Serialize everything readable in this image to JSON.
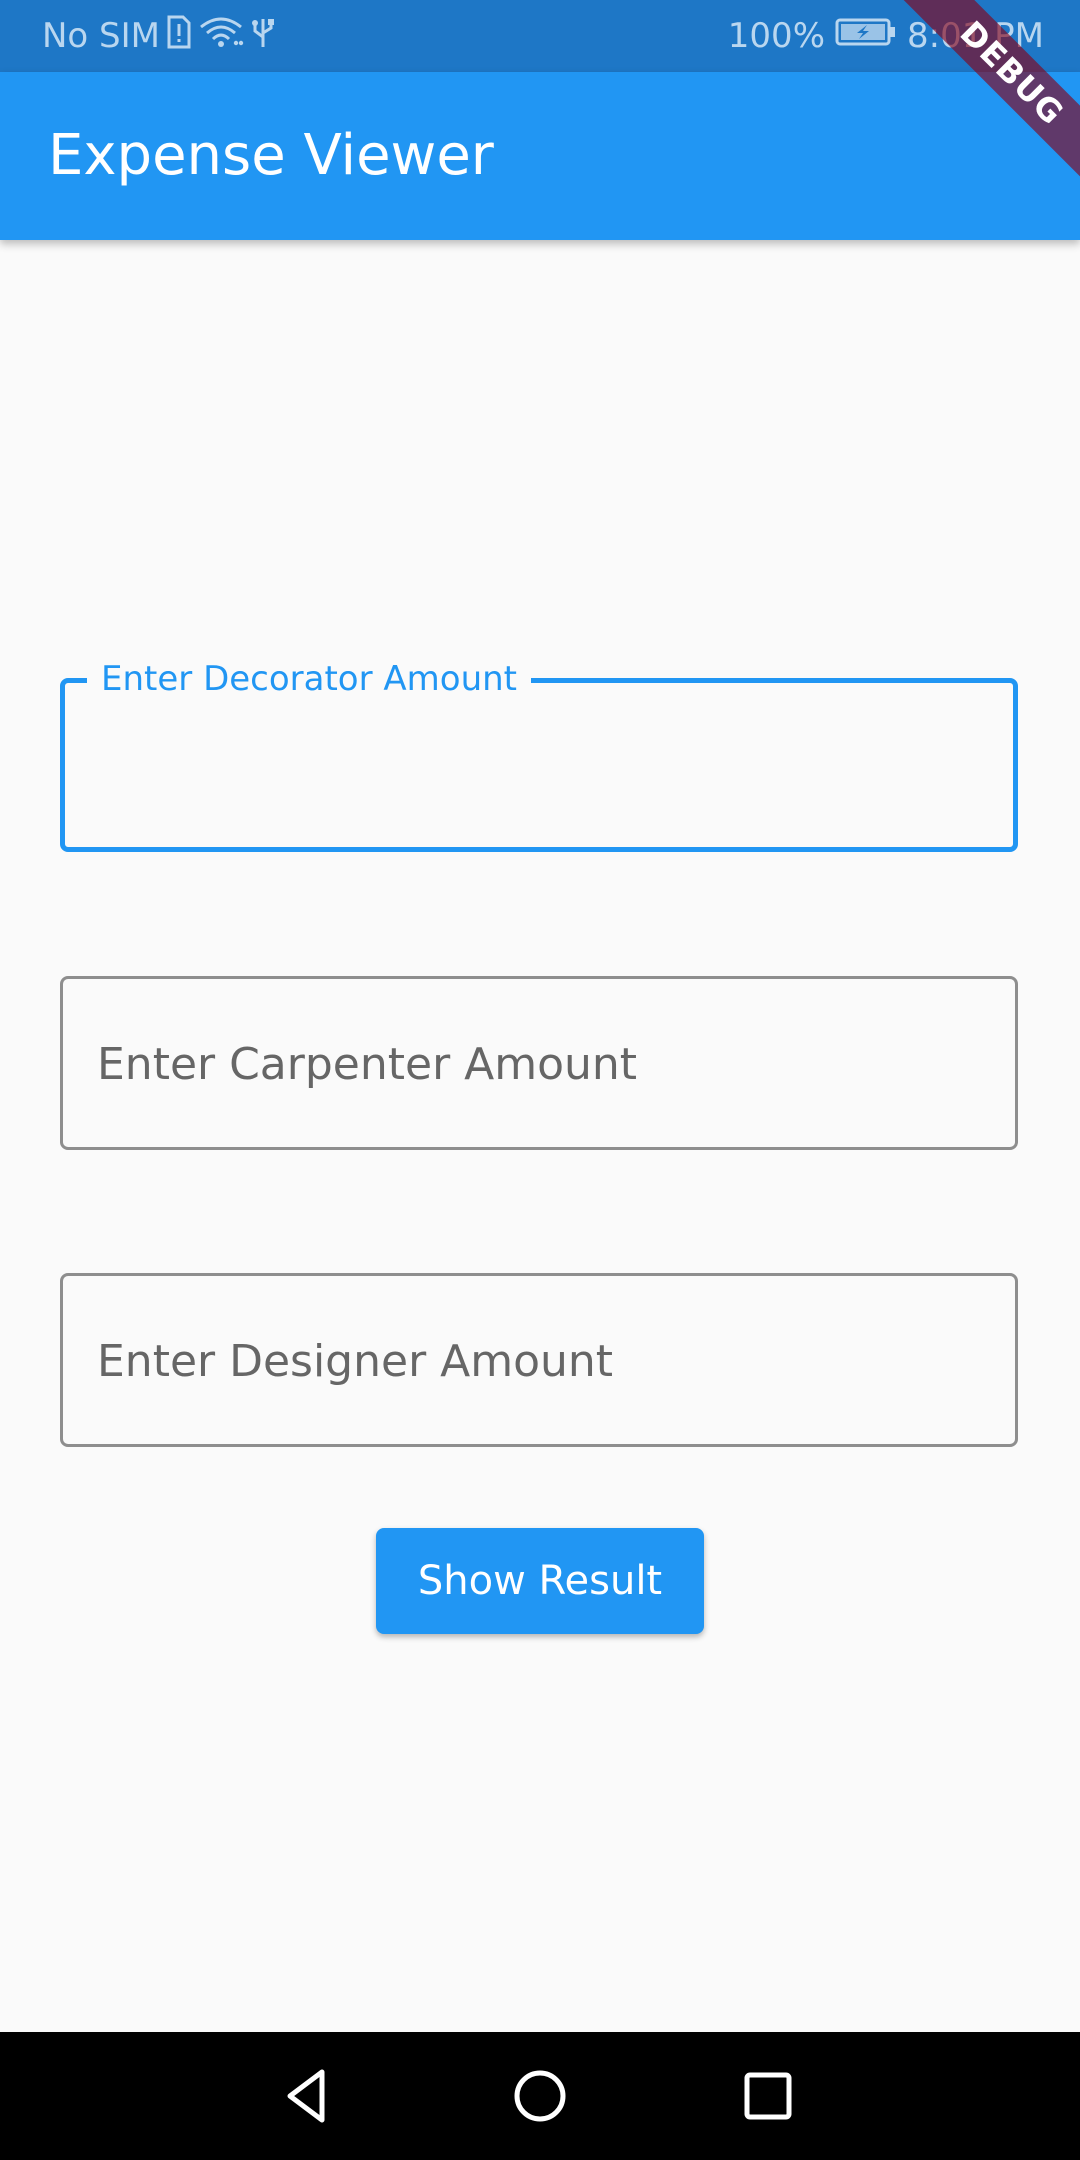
{
  "status_bar": {
    "carrier": "No SIM",
    "battery": "100%",
    "time": "8:01 PM",
    "icons": [
      "sim-alert-icon",
      "wifi-icon",
      "usb-icon",
      "battery-charging-icon"
    ]
  },
  "app_bar": {
    "title": "Expense Viewer",
    "color": "#2196f3"
  },
  "debug_banner": {
    "label": "DEBUG"
  },
  "form": {
    "decorator": {
      "label": "Enter Decorator Amount",
      "value": "",
      "focused": true
    },
    "carpenter": {
      "placeholder": "Enter Carpenter Amount",
      "value": ""
    },
    "designer": {
      "placeholder": "Enter Designer Amount",
      "value": ""
    },
    "submit_label": "Show Result"
  },
  "nav_bar": {
    "icons": [
      "back-icon",
      "home-icon",
      "recents-icon"
    ]
  }
}
